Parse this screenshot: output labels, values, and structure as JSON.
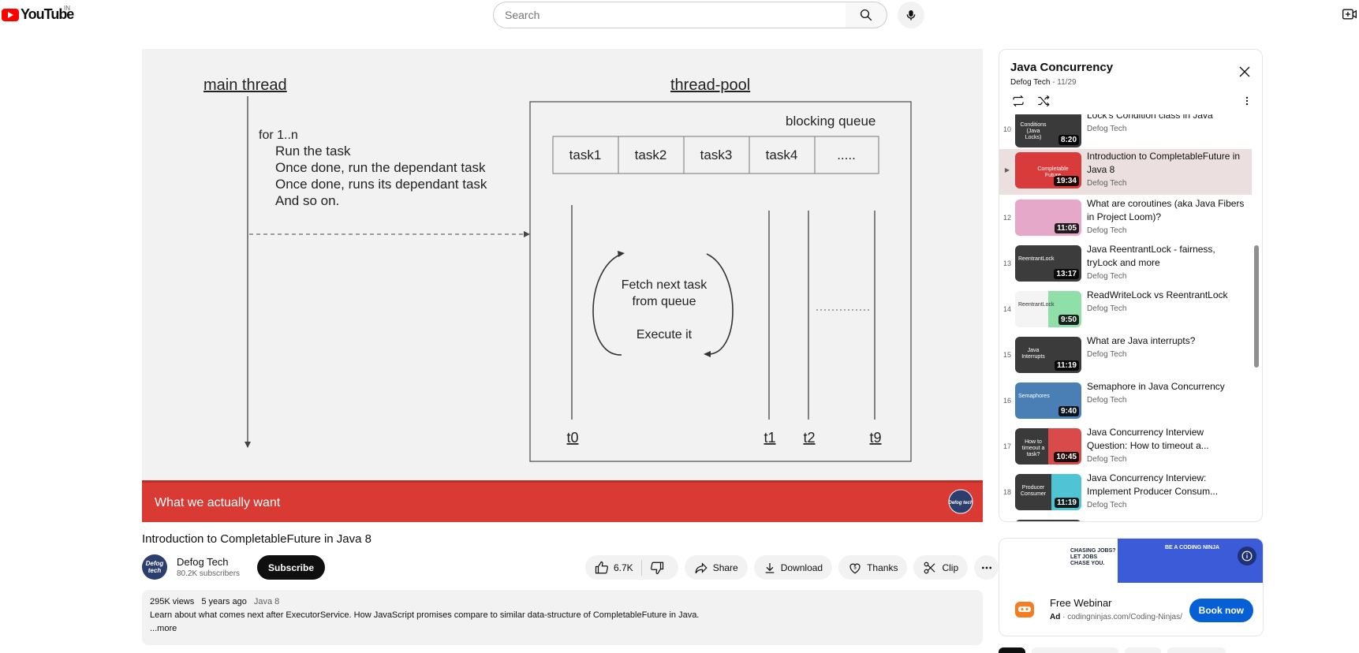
{
  "header": {
    "logo_text": "YouTube",
    "country_code": "IN",
    "search_placeholder": "Search"
  },
  "video": {
    "title": "Introduction to CompletableFuture in Java 8",
    "slide": {
      "main_thread_label": "main thread",
      "thread_pool_label": "thread-pool",
      "blocking_queue_label": "blocking queue",
      "tasks": [
        "task1",
        "task2",
        "task3",
        "task4",
        "....."
      ],
      "loop_lines": [
        "for 1..n",
        "Run the task",
        "Once done, run the dependant task",
        "Once done, runs its dependant task",
        "And so on."
      ],
      "cycle_line1": "Fetch next task",
      "cycle_line2": "from queue",
      "cycle_line3": "Execute it",
      "thread_labels": [
        "t0",
        "t1",
        "t2",
        "t9"
      ],
      "caption": "What we actually want",
      "watermark": "Defog tech"
    }
  },
  "channel": {
    "name": "Defog Tech",
    "subscribers": "80.2K subscribers",
    "avatar_text": "Defog tech",
    "subscribe_label": "Subscribe"
  },
  "actions": {
    "likes": "6.7K",
    "share": "Share",
    "download": "Download",
    "thanks": "Thanks",
    "clip": "Clip"
  },
  "description": {
    "views": "295K views",
    "age": "5 years ago",
    "tag": "Java 8",
    "text": "Learn about what comes next after ExecutorService. How JavaScript promises compare to similar data-structure of CompletableFuture in Java.",
    "more": "...more"
  },
  "playlist": {
    "title": "Java Concurrency",
    "channel": "Defog Tech",
    "position": "11/29",
    "items": [
      {
        "num": "10",
        "title": "Lock's Condition class in Java",
        "channel": "Defog Tech",
        "duration": "8:20",
        "thumb_text": "Conditions (Java Locks)",
        "thumb_color": "#3a3a3a"
      },
      {
        "num": "▶",
        "title": "Introduction to CompletableFuture in Java 8",
        "channel": "Defog Tech",
        "duration": "19:34",
        "thumb_text": "Completable Future",
        "thumb_color": "#d93b3b"
      },
      {
        "num": "12",
        "title": "What are coroutines (aka Java Fibers in Project Loom)?",
        "channel": "Defog Tech",
        "duration": "11:05",
        "thumb_text": "",
        "thumb_color": "#e6a8c8"
      },
      {
        "num": "13",
        "title": "Java ReentrantLock - fairness, tryLock and more",
        "channel": "Defog Tech",
        "duration": "13:17",
        "thumb_text": "ReentrantLock",
        "thumb_color": "#3c3c3c"
      },
      {
        "num": "14",
        "title": "ReadWriteLock vs ReentrantLock",
        "channel": "Defog Tech",
        "duration": "9:50",
        "thumb_text": "ReentrantLock",
        "thumb_color": "#f4f4f4"
      },
      {
        "num": "15",
        "title": "What are Java interrupts?",
        "channel": "Defog Tech",
        "duration": "11:19",
        "thumb_text": "Java Interrupts",
        "thumb_color": "#3b3b3b"
      },
      {
        "num": "16",
        "title": "Semaphore in Java Concurrency",
        "channel": "Defog Tech",
        "duration": "9:40",
        "thumb_text": "Semaphores",
        "thumb_color": "#4a7fb5"
      },
      {
        "num": "17",
        "title": "Java Concurrency Interview Question: How to timeout a...",
        "channel": "Defog Tech",
        "duration": "10:45",
        "thumb_text": "How to timeout a task?",
        "thumb_color": "#3a3a3a"
      },
      {
        "num": "18",
        "title": "Java Concurrency Interview: Implement Producer Consum...",
        "channel": "Defog Tech",
        "duration": "11:19",
        "thumb_text": "Producer Consumer",
        "thumb_color": "#3a3a3a"
      }
    ]
  },
  "ad": {
    "banner_left": "CHASING JOBS? LET JOBS CHASE YOU.",
    "banner_right": "BE A CODING NINJA",
    "name": "Free Webinar",
    "label": "Ad",
    "url": "codingninjas.com/Coding-Ninjas/",
    "cta": "Book now"
  }
}
